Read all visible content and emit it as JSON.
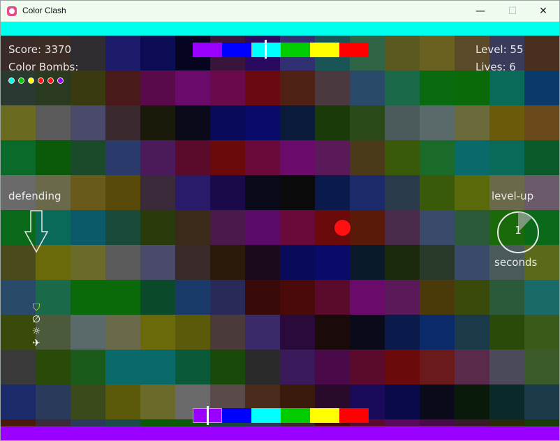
{
  "window": {
    "title": "Color Clash",
    "minimize_glyph": "—",
    "maximize_glyph": "☐",
    "close_glyph": "✕"
  },
  "colors": {
    "top_bar": "#00ffee",
    "bottom_bar": "#9a00ff",
    "player": "#ff1111",
    "text": "#e8e8e8"
  },
  "palette": [
    "#9a00ff",
    "#0000ff",
    "#00ffff",
    "#00cc00",
    "#ffff00",
    "#ff0000"
  ],
  "top_palette_selected_index": 2,
  "bottom_palette_selected_index": 0,
  "hud": {
    "score": "Score: 3370",
    "level": "Level: 55",
    "lives": "Lives: 6",
    "bombs_label": "Color Bombs:",
    "bombs": [
      "#00ffee",
      "#00cc00",
      "#ffff00",
      "#ff1111",
      "#ff1111",
      "#9a00ff"
    ],
    "defending": "defending",
    "level_up": "level-up",
    "seconds": "seconds",
    "timer_value": "1",
    "timer_fraction_elapsed": 0.12
  },
  "powerups": [
    {
      "icon": "shield-icon",
      "glyph": "⛉",
      "color": "#ffdd33"
    },
    {
      "icon": "empty-set-icon",
      "glyph": "∅",
      "color": "#ffffff"
    },
    {
      "icon": "sun-icon",
      "glyph": "☼",
      "color": "#ffffff"
    },
    {
      "icon": "plane-icon",
      "glyph": "✈",
      "color": "#ffffff"
    }
  ],
  "grid": [
    [
      "#3a2a28",
      "#3b2d25",
      "#2e2c30",
      "#1c1c6a",
      "#0c0c55",
      "#050522",
      "#3a143a",
      "#2a0a60",
      "#2f2f72",
      "#1a5555",
      "#2f6444",
      "#5a5a20",
      "#6a6020",
      "#5a4a2a",
      "#3a3a5a",
      "#4a2f1e"
    ],
    [
      "#2a3a30",
      "#2a3a20",
      "#3a3a10",
      "#4a1a1a",
      "#5a0a4a",
      "#6a0a6a",
      "#6a0a4a",
      "#6a0a10",
      "#4f2014",
      "#4a3a40",
      "#2a4a6a",
      "#1a6a4a",
      "#0a6a10",
      "#0a6a0a",
      "#0a6a5a",
      "#0a3a6a"
    ],
    [
      "#6a6a20",
      "#5a5a5a",
      "#4a4a6a",
      "#3a2a30",
      "#1a1a0a",
      "#0a0a1a",
      "#0a0a5a",
      "#0a0a6a",
      "#0a1a3a",
      "#1a3a0a",
      "#2a4a1a",
      "#4a5a5a",
      "#5a6a6a",
      "#6a6a3a",
      "#6a5a0a",
      "#6a4a1a"
    ],
    [
      "#0a6a2a",
      "#0a5a0a",
      "#1a4a2a",
      "#2a3a6a",
      "#4a1a5a",
      "#5a0a2a",
      "#6a0a0a",
      "#6a0a3a",
      "#6a0a6a",
      "#5a1a5a",
      "#4a3a1a",
      "#3a5a0a",
      "#1a6a2a",
      "#0a6a6a",
      "#0a6a5a",
      "#0a5a2a"
    ],
    [
      "#6a6a6a",
      "#6a6a4a",
      "#6a5a1a",
      "#5a4a0a",
      "#3a2a3a",
      "#2a1a6a",
      "#1a0a4a",
      "#0a0a1a",
      "#0a0a0a",
      "#0a1a4a",
      "#1a2a6a",
      "#2a3a4a",
      "#3a5a0a",
      "#5a6a0a",
      "#6a6a4a",
      "#6a5a6a"
    ],
    [
      "#0a6a1a",
      "#0a6a5a",
      "#0a5a6a",
      "#1a4a3a",
      "#2a3a0a",
      "#3a2a1a",
      "#4a1a4a",
      "#5a0a6a",
      "#6a0a3a",
      "#6a0a0a",
      "#5a1a0a",
      "#4a2a4a",
      "#3a4a6a",
      "#2a5a3a",
      "#1a6a0a",
      "#0a6a1a"
    ],
    [
      "#4a4a1a",
      "#6a6a0a",
      "#6a6a2a",
      "#5a5a5a",
      "#4a4a6a",
      "#3a2a2a",
      "#2a1a0a",
      "#1a0a1a",
      "#0a0a5a",
      "#0a0a6a",
      "#0a1a2a",
      "#1a2a0a",
      "#2a3a2a",
      "#3a4a6a",
      "#4a5a5a",
      "#5a6a1a"
    ],
    [
      "#2a4a6a",
      "#1a6a4a",
      "#0a6a0a",
      "#0a6a0a",
      "#0a4a2a",
      "#1a3a6a",
      "#2a2a5a",
      "#3a0a0a",
      "#4a0a0a",
      "#5a0a2a",
      "#6a0a6a",
      "#5a1a5a",
      "#4a3a0a",
      "#3a4a0a",
      "#2a5a3a",
      "#1a6a6a"
    ],
    [
      "#3a4a0a",
      "#4a5a3a",
      "#5a6a6a",
      "#6a6a4a",
      "#6a6a0a",
      "#5a5a0a",
      "#4a3a3a",
      "#3a2a6a",
      "#2a0a3a",
      "#1a0a0a",
      "#0a0a1a",
      "#0a1a4a",
      "#0a2a6a",
      "#1a3a4a",
      "#2a4a0a",
      "#3a5a1a"
    ],
    [
      "#3a3a3a",
      "#2a4a0a",
      "#1a5a1a",
      "#0a6a6a",
      "#0a6a6a",
      "#0a5a3a",
      "#1a4a0a",
      "#2a2a2a",
      "#3a1a5a",
      "#4a0a4a",
      "#5a0a2a",
      "#6a0a0a",
      "#6a1a1a",
      "#5a2a4a",
      "#4a4a5a",
      "#3a5a2a"
    ],
    [
      "#1a2a6a",
      "#2a3a5a",
      "#3a4a1a",
      "#5a5a0a",
      "#6a6a2a",
      "#6a6a6a",
      "#5a4a4a",
      "#4a2a1a",
      "#3a1a0a",
      "#2a0a2a",
      "#1a0a5a",
      "#0a0a4a",
      "#0a0a1a",
      "#0a1a0a",
      "#0a2a2a",
      "#1a3a4a"
    ],
    [
      "#4a1a0a",
      "#3a2a3a",
      "#2a3a5a",
      "#1a4a4a",
      "#0a5a0a",
      "#0a5a0a",
      "#1a4a3a",
      "#2a3a5a",
      "#3a2a2a",
      "#4a0a0a",
      "#5a0a2a",
      "#5a0a5a",
      "#4a0a4a",
      "#3a1a2a",
      "#2a2a0a",
      "#1a3a0a"
    ]
  ]
}
